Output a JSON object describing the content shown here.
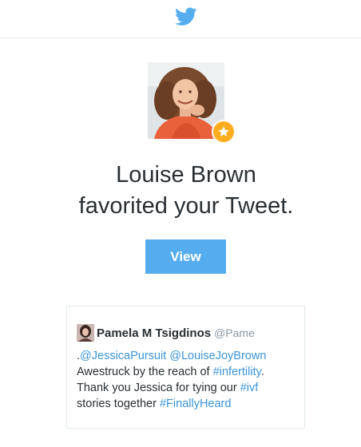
{
  "colors": {
    "brand_blue": "#55acee",
    "link": "#3b94d9",
    "star": "#ffad1f",
    "text": "#292f33",
    "muted": "#8899a6",
    "divider": "#e6ecf0"
  },
  "header": {
    "logo_icon": "twitter-bird-icon"
  },
  "notification": {
    "avatar_icon": "user-avatar",
    "badge_icon": "star-icon",
    "headline_line1": "Louise Brown",
    "headline_line2": "favorited your Tweet.",
    "view_label": "View"
  },
  "tweet": {
    "author_name": "Pamela M Tsigdinos",
    "author_handle": "@Pame",
    "line1_prefix": ".",
    "mention1": "@JessicaPursuit",
    "line1_sep": " ",
    "mention2": "@LouiseJoyBrown",
    "line2_text": "Awestruck by the reach of ",
    "hashtag1": "#infertility",
    "line2_end": ".",
    "line3_text": "Thank you Jessica for tying our ",
    "hashtag2": "#ivf",
    "line4_text": "stories together ",
    "hashtag3": "#FinallyHeard"
  }
}
